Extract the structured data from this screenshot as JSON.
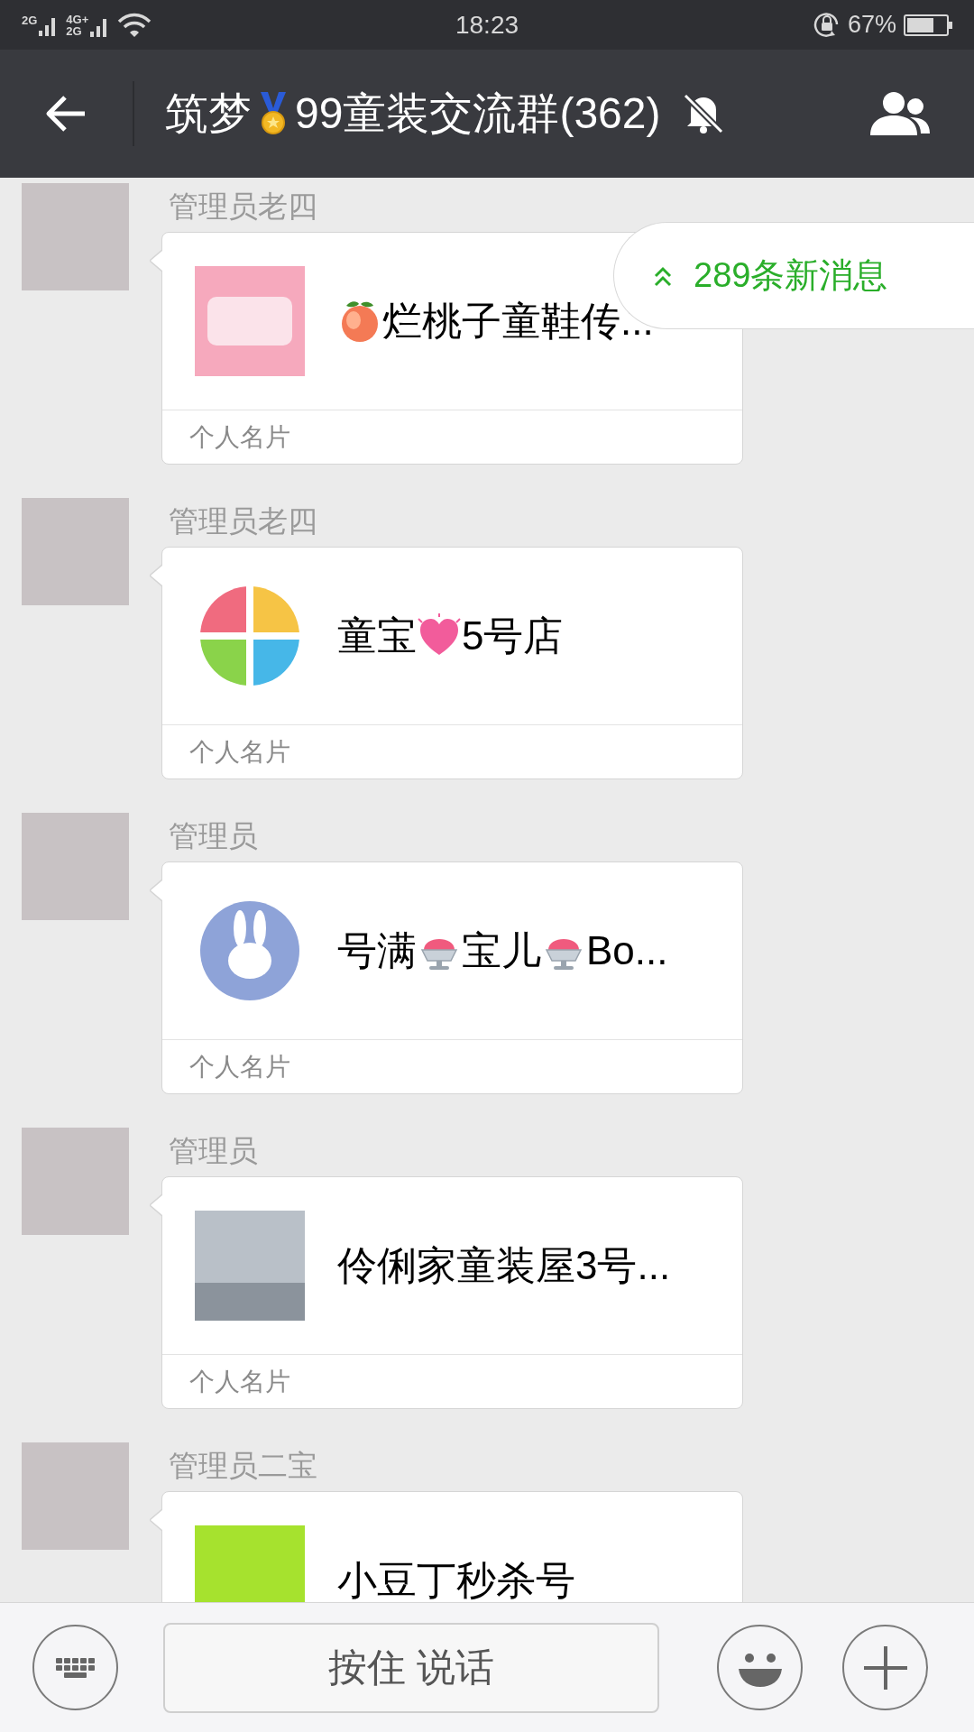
{
  "status_bar": {
    "signal_1_label": "2G",
    "signal_2_label_top": "4G+",
    "signal_2_label_bottom": "2G",
    "time": "18:23",
    "battery_percent": "67%"
  },
  "header": {
    "title_parts": [
      {
        "kind": "text",
        "text": "筑梦"
      },
      {
        "kind": "medal"
      },
      {
        "kind": "text",
        "text": "99童装交流群(362)"
      }
    ],
    "muted": true
  },
  "messages": [
    {
      "sender": "管理员老四",
      "card": {
        "thumbnail": {
          "kind": "pink-logo"
        },
        "title_parts": [
          {
            "kind": "peach"
          },
          {
            "kind": "text",
            "text": "烂桃子童鞋传..."
          }
        ],
        "footer": "个人名片"
      }
    },
    {
      "sender": "管理员老四",
      "card": {
        "thumbnail": {
          "kind": "quad-circle"
        },
        "title_parts": [
          {
            "kind": "text",
            "text": "童宝"
          },
          {
            "kind": "heart"
          },
          {
            "kind": "text",
            "text": "5号店"
          }
        ],
        "footer": "个人名片"
      }
    },
    {
      "sender": "管理员",
      "card": {
        "thumbnail": {
          "kind": "rabbit-circle"
        },
        "title_parts": [
          {
            "kind": "text",
            "text": "号满"
          },
          {
            "kind": "shaved-ice"
          },
          {
            "kind": "text",
            "text": "宝儿"
          },
          {
            "kind": "shaved-ice"
          },
          {
            "kind": "text",
            "text": "Bo..."
          }
        ],
        "footer": "个人名片"
      }
    },
    {
      "sender": "管理员",
      "card": {
        "thumbnail": {
          "kind": "photo"
        },
        "title_parts": [
          {
            "kind": "text",
            "text": "伶俐家童装屋3号..."
          }
        ],
        "footer": "个人名片"
      }
    },
    {
      "sender": "管理员二宝",
      "card": {
        "thumbnail": {
          "kind": "lime-logo"
        },
        "title_parts": [
          {
            "kind": "text",
            "text": "小豆丁秒杀号"
          }
        ]
      }
    }
  ],
  "new_messages_banner": "289条新消息",
  "input_bar": {
    "hold_to_talk": "按住 说话"
  }
}
